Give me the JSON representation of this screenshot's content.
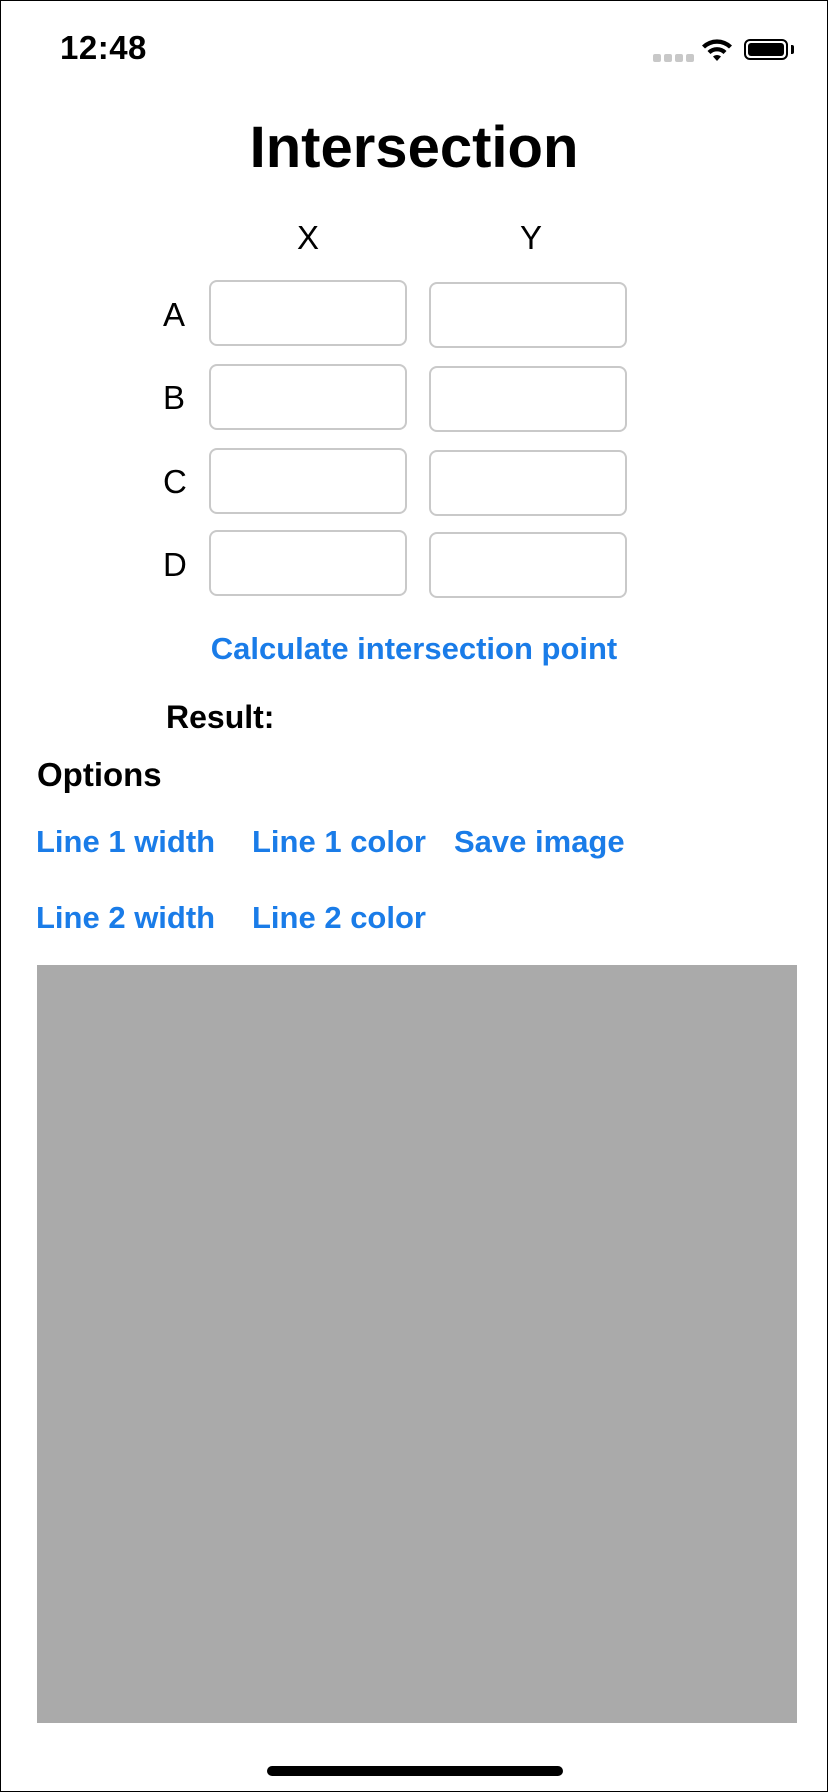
{
  "status_bar": {
    "time": "12:48",
    "icons": [
      "signal-dots-icon",
      "wifi-icon",
      "battery-icon"
    ]
  },
  "title": "Intersection",
  "columns": {
    "x": "X",
    "y": "Y"
  },
  "rows": [
    {
      "label": "A",
      "x_value": "",
      "y_value": ""
    },
    {
      "label": "B",
      "x_value": "",
      "y_value": ""
    },
    {
      "label": "C",
      "x_value": "",
      "y_value": ""
    },
    {
      "label": "D",
      "x_value": "",
      "y_value": ""
    }
  ],
  "calculate_button": "Calculate intersection point",
  "result_label": "Result:",
  "options": {
    "title": "Options",
    "line1_width": "Line 1 width",
    "line1_color": "Line 1 color",
    "save_image": "Save image",
    "line2_width": "Line 2 width",
    "line2_color": "Line 2 color"
  },
  "colors": {
    "link": "#1a7ce8",
    "canvas": "#aaaaaa",
    "field_border": "#c9c9c9"
  }
}
